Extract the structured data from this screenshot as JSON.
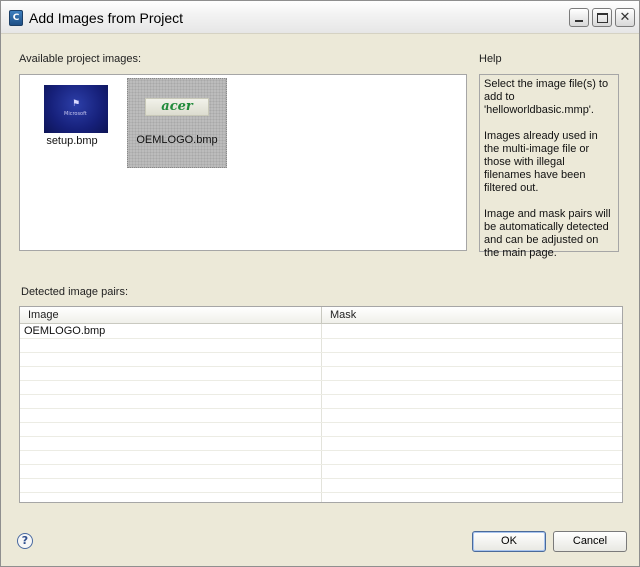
{
  "window": {
    "title": "Add Images from Project",
    "icon_glyph": "C",
    "close_glyph": "✕"
  },
  "available": {
    "label": "Available project images:",
    "items": [
      {
        "name": "setup.bmp",
        "selected": false,
        "thumb_icon": "windows-setup-image"
      },
      {
        "name": "OEMLOGO.bmp",
        "selected": true,
        "thumb_icon": "acer-logo-image",
        "thumb_text": "acer"
      }
    ]
  },
  "help": {
    "label": "Help",
    "paragraphs": [
      "Select the image file(s) to add to 'helloworldbasic.mmp'.",
      "Images already used in the multi-image file or those with illegal filenames have been filtered out.",
      "Image and mask pairs will be automatically detected and can be adjusted on the main page."
    ]
  },
  "pairs": {
    "label": "Detected image pairs:",
    "columns": [
      "Image",
      "Mask"
    ],
    "rows": [
      [
        "OEMLOGO.bmp",
        ""
      ],
      [
        "",
        ""
      ],
      [
        "",
        ""
      ],
      [
        "",
        ""
      ],
      [
        "",
        ""
      ],
      [
        "",
        ""
      ],
      [
        "",
        ""
      ],
      [
        "",
        ""
      ],
      [
        "",
        ""
      ],
      [
        "",
        ""
      ],
      [
        "",
        ""
      ],
      [
        "",
        ""
      ],
      [
        "",
        ""
      ]
    ]
  },
  "footer": {
    "help_glyph": "?",
    "ok_label": "OK",
    "cancel_label": "Cancel"
  }
}
